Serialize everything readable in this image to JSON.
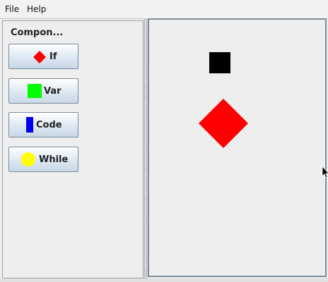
{
  "menu": {
    "file": "File",
    "help": "Help"
  },
  "components_panel": {
    "title": "Compon...",
    "buttons": [
      {
        "label": "If",
        "icon": "red-diamond-icon",
        "color": "#ff0000"
      },
      {
        "label": "Var",
        "icon": "green-square-icon",
        "color": "#00ff00"
      },
      {
        "label": "Code",
        "icon": "blue-rectangle-icon",
        "color": "#0000ee"
      },
      {
        "label": "While",
        "icon": "yellow-circle-icon",
        "color": "#ffff00"
      }
    ]
  },
  "canvas": {
    "shapes": [
      {
        "type": "square",
        "color": "#000000"
      },
      {
        "type": "diamond",
        "color": "#ff0000"
      }
    ]
  }
}
